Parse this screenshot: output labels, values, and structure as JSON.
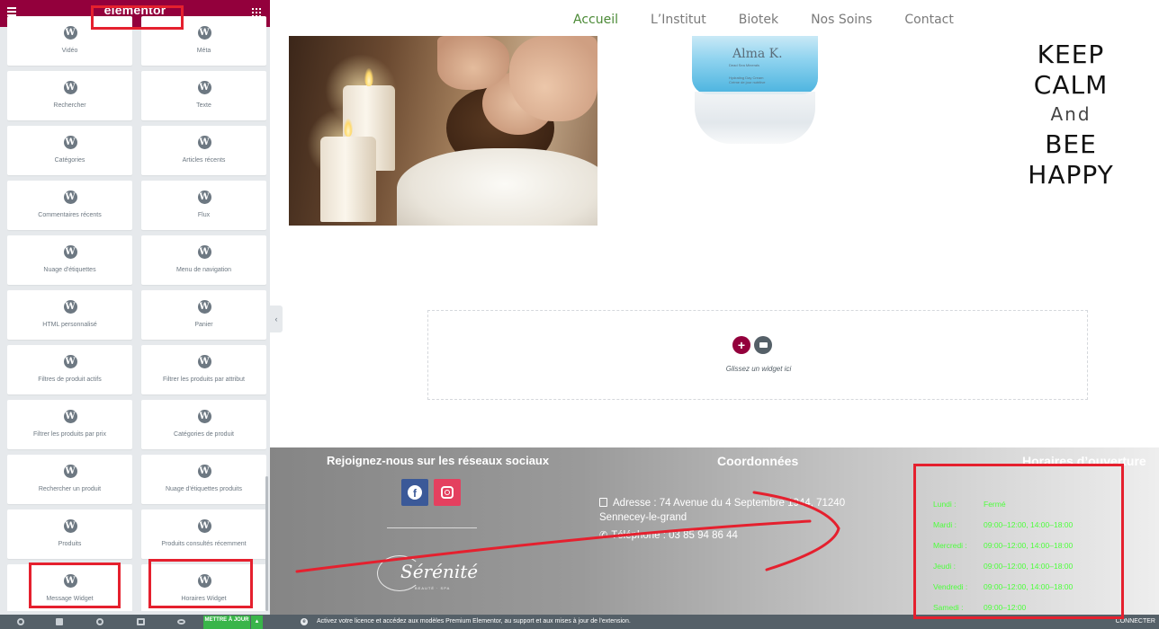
{
  "editor": {
    "brand": "elementor",
    "widgets": [
      {
        "label": "Vidéo"
      },
      {
        "label": "Méta"
      },
      {
        "label": "Rechercher"
      },
      {
        "label": "Texte"
      },
      {
        "label": "Catégories"
      },
      {
        "label": "Articles récents"
      },
      {
        "label": "Commentaires récents"
      },
      {
        "label": "Flux"
      },
      {
        "label": "Nuage d'étiquettes"
      },
      {
        "label": "Menu de navigation"
      },
      {
        "label": "HTML personnalisé"
      },
      {
        "label": "Panier"
      },
      {
        "label": "Filtres de produit actifs"
      },
      {
        "label": "Filtrer les produits par attribut"
      },
      {
        "label": "Filtrer les produits par prix"
      },
      {
        "label": "Catégories de produit"
      },
      {
        "label": "Rechercher un produit"
      },
      {
        "label": "Nuage d'étiquettes produits"
      },
      {
        "label": "Produits"
      },
      {
        "label": "Produits consultés récemment"
      },
      {
        "label": "Message Widget"
      },
      {
        "label": "Horaires Widget"
      }
    ],
    "footer": {
      "update_label": "METTRE À JOUR"
    }
  },
  "site": {
    "nav": [
      "Accueil",
      "L’Institut",
      "Biotek",
      "Nos Soins",
      "Contact"
    ],
    "jar": {
      "brand": "Alma K.",
      "sub": "Dead Sea Minerals",
      "product_line1": "Hydrating Day Cream",
      "product_line2": "Crème de jour nutritive"
    },
    "keep_calm": {
      "l1": "KEEP",
      "l2": "CALM",
      "l3": "And",
      "l4": "BEE",
      "l5": "HAPPY"
    },
    "dropzone_text": "Glissez un widget ici",
    "footer": {
      "social_title": "Rejoignez-nous sur les réseaux sociaux",
      "coord_title": "Coordonnées",
      "hours_title": "Horaires d’ouverture",
      "address": "Adresse : 74 Avenue du 4 Septembre 1944, 71240 Sennecey-le-grand",
      "phone": "Téléphone : 03 85 94 86 44",
      "logo_word": "Sérénité",
      "logo_tag": "BEAUTÉ · SPA",
      "hours": [
        {
          "day": "Lundi :",
          "value": "Fermé"
        },
        {
          "day": "Mardi :",
          "value": "09:00–12:00, 14:00–18:00"
        },
        {
          "day": "Mercredi :",
          "value": "09:00–12:00, 14:00–18:00"
        },
        {
          "day": "Jeudi :",
          "value": "09:00–12:00, 14:00–18:00"
        },
        {
          "day": "Vendredi :",
          "value": "09:00–12:00, 14:00–18:00"
        },
        {
          "day": "Samedi :",
          "value": "09:00–12:00"
        }
      ]
    }
  },
  "admin_bar": {
    "notice": "Activez votre licence et accédez aux modèles Premium Elementor, au support et aux mises à jour de l'extension.",
    "connect": "CONNECTER"
  },
  "colors": {
    "elementor_accent": "#93003c",
    "hours_text": "#4dff3c",
    "annotation": "#e5202e",
    "nav_active": "#4b8a36"
  }
}
